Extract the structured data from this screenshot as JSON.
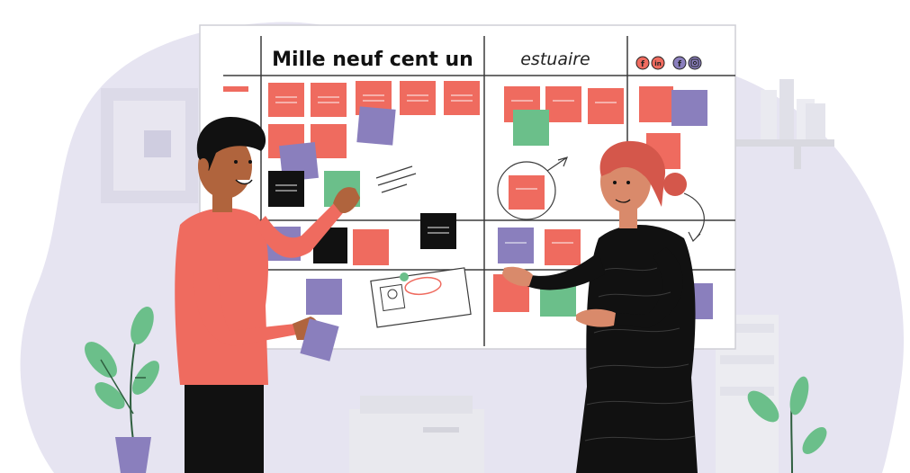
{
  "board": {
    "title": "Mille neuf cent un",
    "brand": "estuaire",
    "social_icons": [
      "facebook-icon",
      "linkedin-icon",
      "facebook-icon",
      "instagram-icon"
    ]
  },
  "colors": {
    "background_blob": "#e6e4f1",
    "board": "#ffffff",
    "board_lines": "#3b3b3b",
    "note_red": "#ef6b5f",
    "note_purple": "#8a7fbd",
    "note_green": "#6bbf8a",
    "note_black": "#111111",
    "shirt": "#ef6b5f",
    "dress": "#111111",
    "plant": "#6bbf8a",
    "pot": "#8a7fbd",
    "furniture": "#e9e9ee"
  }
}
